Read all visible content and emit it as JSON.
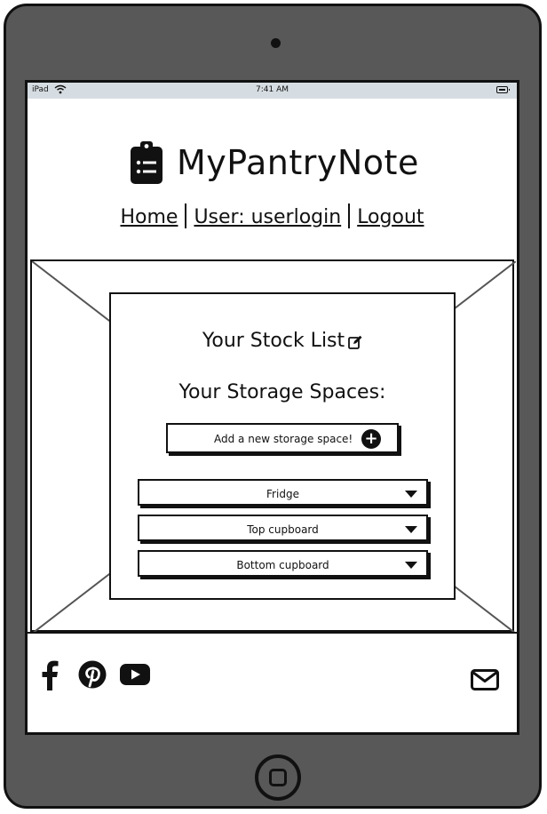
{
  "statusbar": {
    "carrier": "iPad",
    "time": "7:41 AM"
  },
  "brand": {
    "name": "MyPantryNote",
    "logo_icon": "clipboard-list-icon"
  },
  "nav": [
    {
      "label": "Home"
    },
    {
      "label": "User: userlogin"
    },
    {
      "label": "Logout"
    }
  ],
  "stock": {
    "title": "Your Stock List",
    "icon": "edit-icon"
  },
  "storage": {
    "title": "Your Storage Spaces:",
    "add_label": "Add a new storage space!",
    "spaces": [
      {
        "label": "Fridge"
      },
      {
        "label": "Top cupboard"
      },
      {
        "label": "Bottom cupboard"
      }
    ]
  },
  "footer": {
    "social_icons": [
      "facebook-icon",
      "pinterest-icon",
      "youtube-icon"
    ],
    "contact_icon": "envelope-icon"
  },
  "colors": {
    "device": "#585858",
    "statusbar": "#d6dde2",
    "ink": "#111111"
  }
}
